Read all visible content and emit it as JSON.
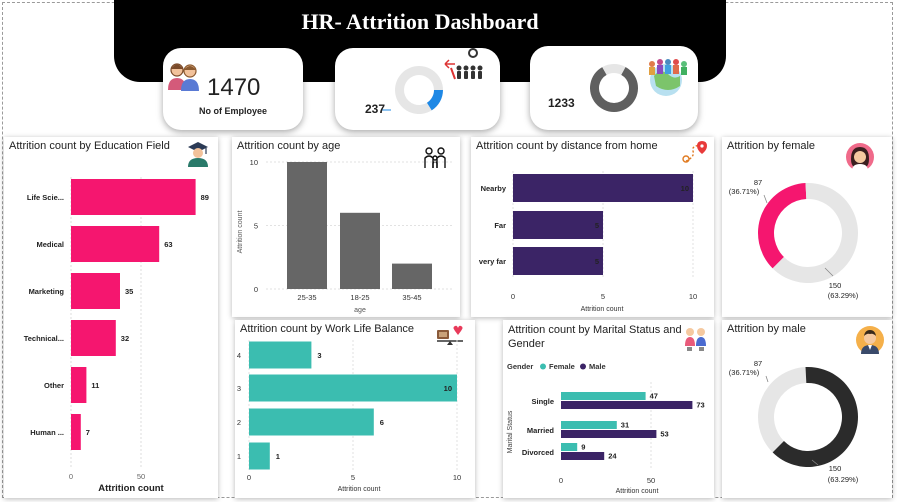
{
  "header": {
    "title": "HR- Attrition Dashboard"
  },
  "kpis": {
    "employees": {
      "value": "1470",
      "label": "No of Employee"
    },
    "attrition": {
      "value": "237",
      "share": 0.161
    },
    "active": {
      "value": "1233",
      "share": 0.839
    }
  },
  "colors": {
    "pink": "#f5166f",
    "gray": "#666666",
    "purple": "#3b2466",
    "teal": "#3bbdb0",
    "darkblue": "#3b2466",
    "blue": "#1e88e5",
    "light": "#e6e6e6",
    "dark": "#2b2b2b"
  },
  "charts": {
    "education": {
      "title": "Attrition count by Education Field",
      "xlabel": "Attrition count",
      "icon": "graduate-icon",
      "chart_data": {
        "type": "bar",
        "categories": [
          "Life Scie...",
          "Medical",
          "Marketing",
          "Technical...",
          "Other",
          "Human ..."
        ],
        "values": [
          89,
          63,
          35,
          32,
          11,
          7
        ],
        "xticks": [
          "0",
          "50"
        ],
        "xlim": [
          0,
          100
        ]
      }
    },
    "age": {
      "title": "Attrition count by age",
      "xlabel": "age",
      "ylabel": "Attrition count",
      "icon": "family-icon",
      "chart_data": {
        "type": "bar",
        "categories": [
          "25-35",
          "18-25",
          "35-45"
        ],
        "values": [
          10,
          6,
          2
        ],
        "yticks": [
          "0",
          "5",
          "10"
        ],
        "ylim": [
          0,
          10
        ]
      }
    },
    "distance": {
      "title": "Attrition count by distance from home",
      "xlabel": "Attrition count",
      "icon": "route-pin-icon",
      "chart_data": {
        "type": "bar",
        "categories": [
          "Nearby",
          "Far",
          "very far"
        ],
        "values": [
          10,
          5,
          5
        ],
        "xticks": [
          "0",
          "5",
          "10"
        ],
        "xlim": [
          0,
          10
        ]
      }
    },
    "wlb": {
      "title": "Attrition count by Work Life Balance",
      "xlabel": "Attrition count",
      "icon": "balance-icon",
      "chart_data": {
        "type": "bar",
        "categories": [
          "4",
          "3",
          "2",
          "1"
        ],
        "values": [
          3,
          10,
          6,
          1
        ],
        "xticks": [
          "0",
          "5",
          "10"
        ],
        "xlim": [
          0,
          10
        ]
      }
    },
    "marital": {
      "title": "Attrition count by Marital Status and Gender",
      "title_line1": "Attrition count by Marital Status and",
      "title_line2": "Gender",
      "legend_title": "Gender",
      "xlabel": "Attrition count",
      "ylabel": "Marital Status",
      "icon": "couple-icon",
      "chart_data": {
        "type": "bar",
        "categories": [
          "Single",
          "Married",
          "Divorced"
        ],
        "series": [
          {
            "name": "Female",
            "values": [
              47,
              31,
              9
            ]
          },
          {
            "name": "Male",
            "values": [
              73,
              53,
              24
            ]
          }
        ],
        "xticks": [
          "0",
          "50"
        ],
        "xlim": [
          0,
          100
        ]
      }
    },
    "female": {
      "title": "Attrition by female",
      "icon": "woman-avatar-icon",
      "chart_data": {
        "type": "pie",
        "slices": [
          {
            "value": 87,
            "label": "87",
            "pct": "(36.71%)"
          },
          {
            "value": 150,
            "label": "150",
            "pct": "(63.29%)"
          }
        ]
      }
    },
    "male": {
      "title": "Attrition by male",
      "icon": "man-avatar-icon",
      "chart_data": {
        "type": "pie",
        "slices": [
          {
            "value": 87,
            "label": "87",
            "pct": "(36.71%)"
          },
          {
            "value": 150,
            "label": "150",
            "pct": "(63.29%)"
          }
        ]
      }
    }
  }
}
